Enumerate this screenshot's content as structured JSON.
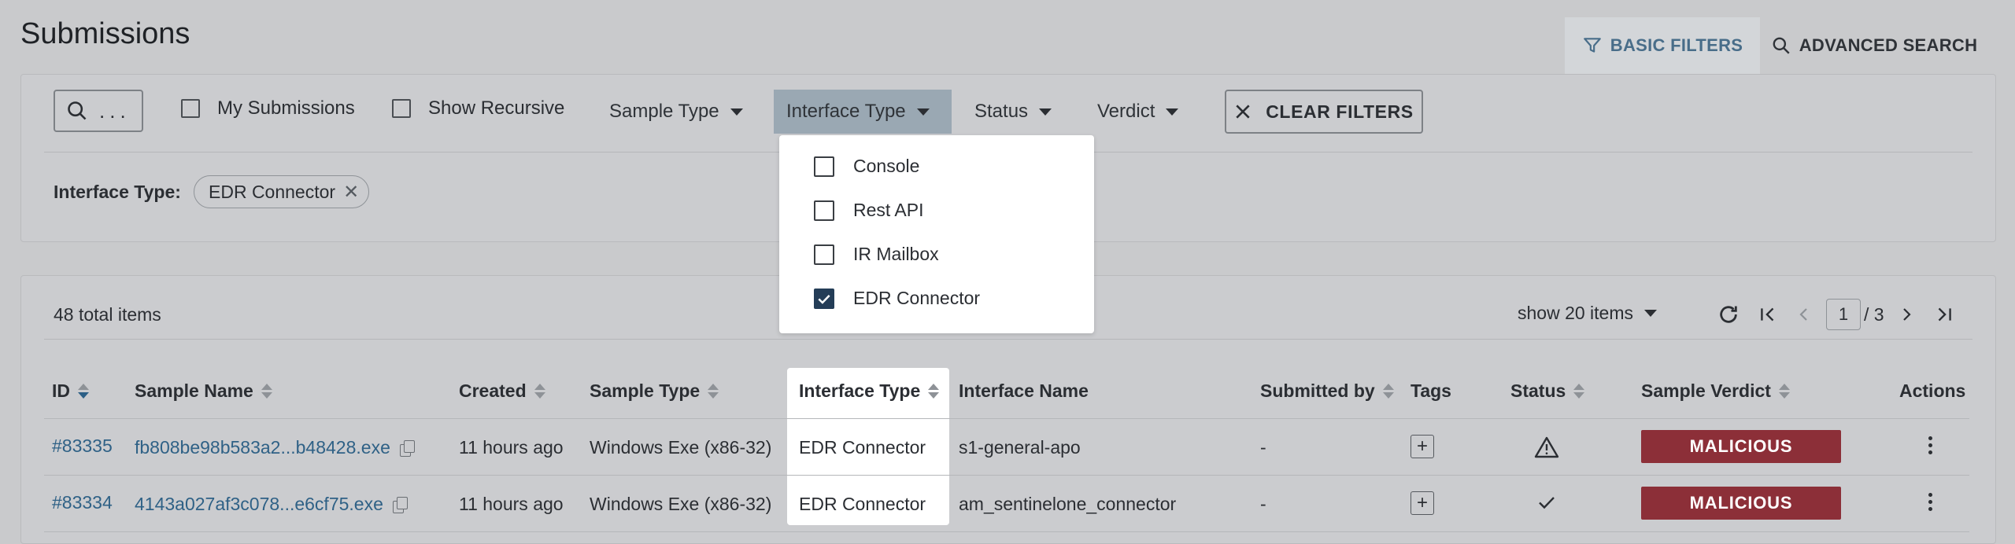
{
  "page": {
    "title": "Submissions"
  },
  "tabs": {
    "basic": "BASIC FILTERS",
    "advanced": "ADVANCED SEARCH"
  },
  "filters": {
    "search_placeholder": "...",
    "my_submissions": "My Submissions",
    "show_recursive": "Show Recursive",
    "sample_type": "Sample Type",
    "interface_type": "Interface Type",
    "status": "Status",
    "verdict": "Verdict",
    "clear": "CLEAR FILTERS",
    "applied_label": "Interface Type:",
    "applied_chip": "EDR Connector"
  },
  "interface_menu": {
    "options": [
      {
        "label": "Console",
        "checked": false
      },
      {
        "label": "Rest API",
        "checked": false
      },
      {
        "label": "IR Mailbox",
        "checked": false
      },
      {
        "label": "EDR Connector",
        "checked": true
      }
    ]
  },
  "results": {
    "total": "48 total items",
    "show_items": "show 20 items",
    "page": "1",
    "page_total": "/ 3"
  },
  "table": {
    "headers": [
      "ID",
      "Sample Name",
      "Created",
      "Sample Type",
      "Interface Type",
      "Interface Name",
      "Submitted by",
      "Tags",
      "Status",
      "Sample Verdict",
      "Actions"
    ],
    "rows": [
      {
        "id": "#83335",
        "name": "fb808be98b583a2...b48428.exe",
        "created": "11 hours ago",
        "type": "Windows Exe (x86-32)",
        "iface": "EDR Connector",
        "iface_name": "s1-general-apo",
        "by": "-",
        "tag": "+",
        "status": "warning",
        "verdict": "MALICIOUS"
      },
      {
        "id": "#83334",
        "name": "4143a027af3c078...e6cf75.exe",
        "created": "11 hours ago",
        "type": "Windows Exe (x86-32)",
        "iface": "EDR Connector",
        "iface_name": "am_sentinelone_connector",
        "by": "-",
        "tag": "+",
        "status": "done",
        "verdict": "MALICIOUS"
      }
    ]
  },
  "colors": {
    "malicious": "#8c2f38",
    "accent": "#2f6186",
    "check": "#243d57"
  }
}
